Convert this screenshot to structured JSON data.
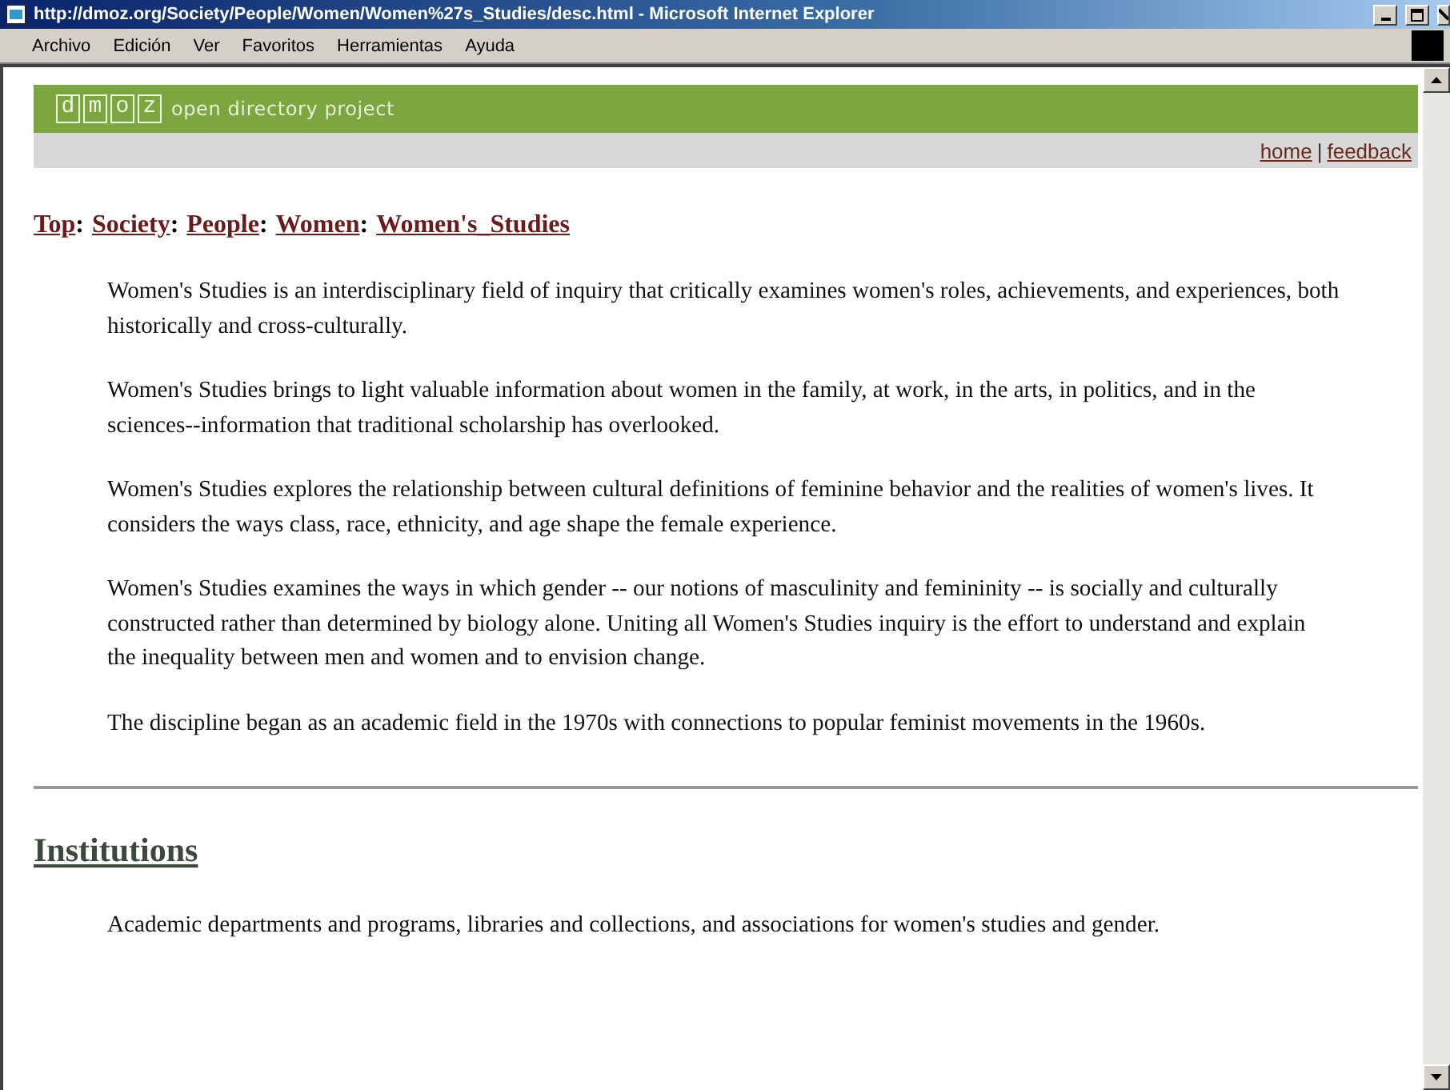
{
  "window": {
    "title": "http://dmoz.org/Society/People/Women/Women%27s_Studies/desc.html - Microsoft Internet Explorer"
  },
  "menu": [
    "Archivo",
    "Edición",
    "Ver",
    "Favoritos",
    "Herramientas",
    "Ayuda"
  ],
  "banner": {
    "logo_letters": [
      "d",
      "m",
      "o",
      "z"
    ],
    "tagline": "open directory project"
  },
  "top_links": {
    "links": [
      "home",
      "feedback"
    ],
    "separator": "|"
  },
  "breadcrumb": {
    "items": [
      "Top",
      "Society",
      "People",
      "Women",
      "Women's_Studies"
    ],
    "separator": ":"
  },
  "paragraphs": [
    "Women's Studies is an interdisciplinary field of inquiry that critically examines women's roles, achievements, and experiences, both historically and cross-culturally.",
    "Women's Studies brings to light valuable information about women in the family, at work, in the arts, in politics, and in the sciences--information that traditional scholarship has overlooked.",
    "Women's Studies explores the relationship between cultural definitions of feminine behavior and the realities of women's lives. It considers the ways class, race, ethnicity, and age shape the female experience.",
    "Women's Studies examines the ways in which gender -- our notions of masculinity and femininity -- is socially and culturally constructed rather than determined by biology alone. Uniting all Women's Studies inquiry is the effort to understand and explain the inequality between men and women and to envision change.",
    "The discipline began as an academic field in the 1970s with connections to popular feminist movements in the 1960s."
  ],
  "section": {
    "heading": "Institutions",
    "description": "Academic departments and programs, libraries and collections, and associations for women's studies and gender."
  }
}
